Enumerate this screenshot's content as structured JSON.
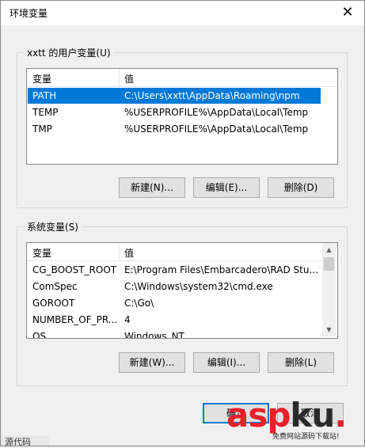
{
  "window": {
    "title": "环境变量",
    "close_glyph": "✕"
  },
  "user_group": {
    "label": "xxtt 的用户变量(U)",
    "columns": [
      "变量",
      "值"
    ],
    "rows": [
      {
        "name": "PATH",
        "value": "C:\\Users\\xxtt\\AppData\\Roaming\\npm",
        "selected": true
      },
      {
        "name": "TEMP",
        "value": "%USERPROFILE%\\AppData\\Local\\Temp",
        "selected": false
      },
      {
        "name": "TMP",
        "value": "%USERPROFILE%\\AppData\\Local\\Temp",
        "selected": false
      }
    ],
    "buttons": {
      "new": "新建(N)...",
      "edit": "编辑(E)...",
      "delete": "删除(D)"
    }
  },
  "system_group": {
    "label": "系统变量(S)",
    "columns": [
      "变量",
      "值"
    ],
    "rows": [
      {
        "name": "CG_BOOST_ROOT",
        "value": "E:\\Program Files\\Embarcadero\\RAD Stu...",
        "selected": false
      },
      {
        "name": "ComSpec",
        "value": "C:\\Windows\\system32\\cmd.exe",
        "selected": false
      },
      {
        "name": "GOROOT",
        "value": "C:\\Go\\",
        "selected": false
      },
      {
        "name": "NUMBER_OF_PR...",
        "value": "4",
        "selected": false
      },
      {
        "name": "OS",
        "value": "Windows_NT",
        "selected": false
      }
    ],
    "buttons": {
      "new": "新建(W)...",
      "edit": "编辑(I)...",
      "delete": "删除(L)"
    }
  },
  "footer": {
    "ok": "确定",
    "cancel": "取消"
  },
  "watermark": {
    "main": "asp",
    "ku": "ku",
    "dot": ".",
    "sub": "免费网站源码下载站!"
  },
  "behind_window_text": "源代码"
}
